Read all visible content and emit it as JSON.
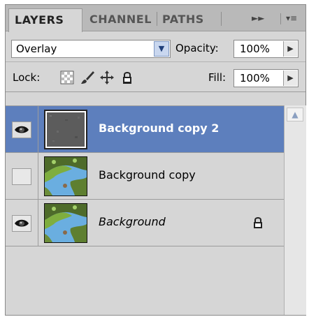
{
  "tabs": [
    {
      "label": "LAYERS",
      "active": true
    },
    {
      "label": "CHANNEL",
      "active": false
    },
    {
      "label": "PATHS",
      "active": false
    }
  ],
  "tab_menu": {
    "expand_glyph": "►►",
    "menu_glyph": "▾≡"
  },
  "blend": {
    "mode": "Overlay",
    "opacity_label": "Opacity:",
    "opacity": "100%"
  },
  "lock": {
    "label": "Lock:",
    "fill_label": "Fill:",
    "fill": "100%",
    "icons": [
      "lock-transparent-icon",
      "brush-icon",
      "move-icon",
      "lock-all-icon"
    ]
  },
  "layers": [
    {
      "name": "Background copy 2",
      "visible": true,
      "selected": true,
      "locked": false,
      "italic": false,
      "thumb": "gray-noise"
    },
    {
      "name": "Background copy",
      "visible": false,
      "selected": false,
      "locked": false,
      "italic": false,
      "thumb": "river"
    },
    {
      "name": "Background",
      "visible": true,
      "selected": false,
      "locked": true,
      "italic": true,
      "thumb": "river"
    }
  ],
  "colors": {
    "panel": "#d6d6d6",
    "selected_row": "#5d7fbd",
    "tabbar": "#b9b9b9"
  }
}
